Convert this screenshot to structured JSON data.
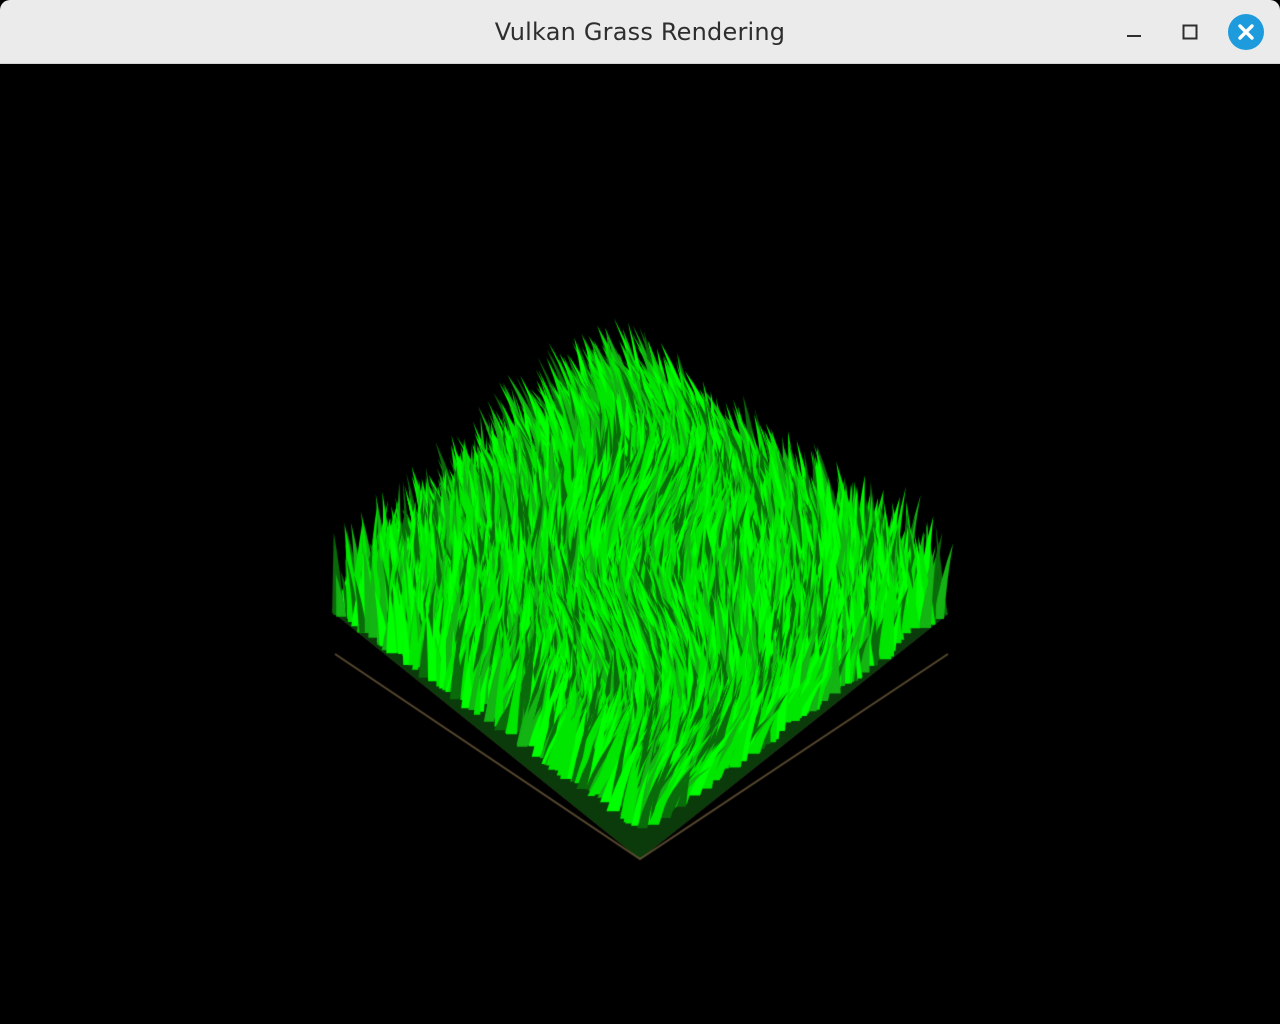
{
  "window": {
    "title": "Vulkan Grass Rendering"
  },
  "titlebar_buttons": {
    "minimize": {
      "icon": "minimize-icon"
    },
    "maximize": {
      "icon": "maximize-icon"
    },
    "close": {
      "icon": "close-icon",
      "color": "#1e9bdc"
    }
  },
  "scene": {
    "background_color": "#000000",
    "grass_color_bright": "#00ff00",
    "grass_color_dark": "#0a4d0a",
    "ground_color": "#6b5a3a"
  }
}
